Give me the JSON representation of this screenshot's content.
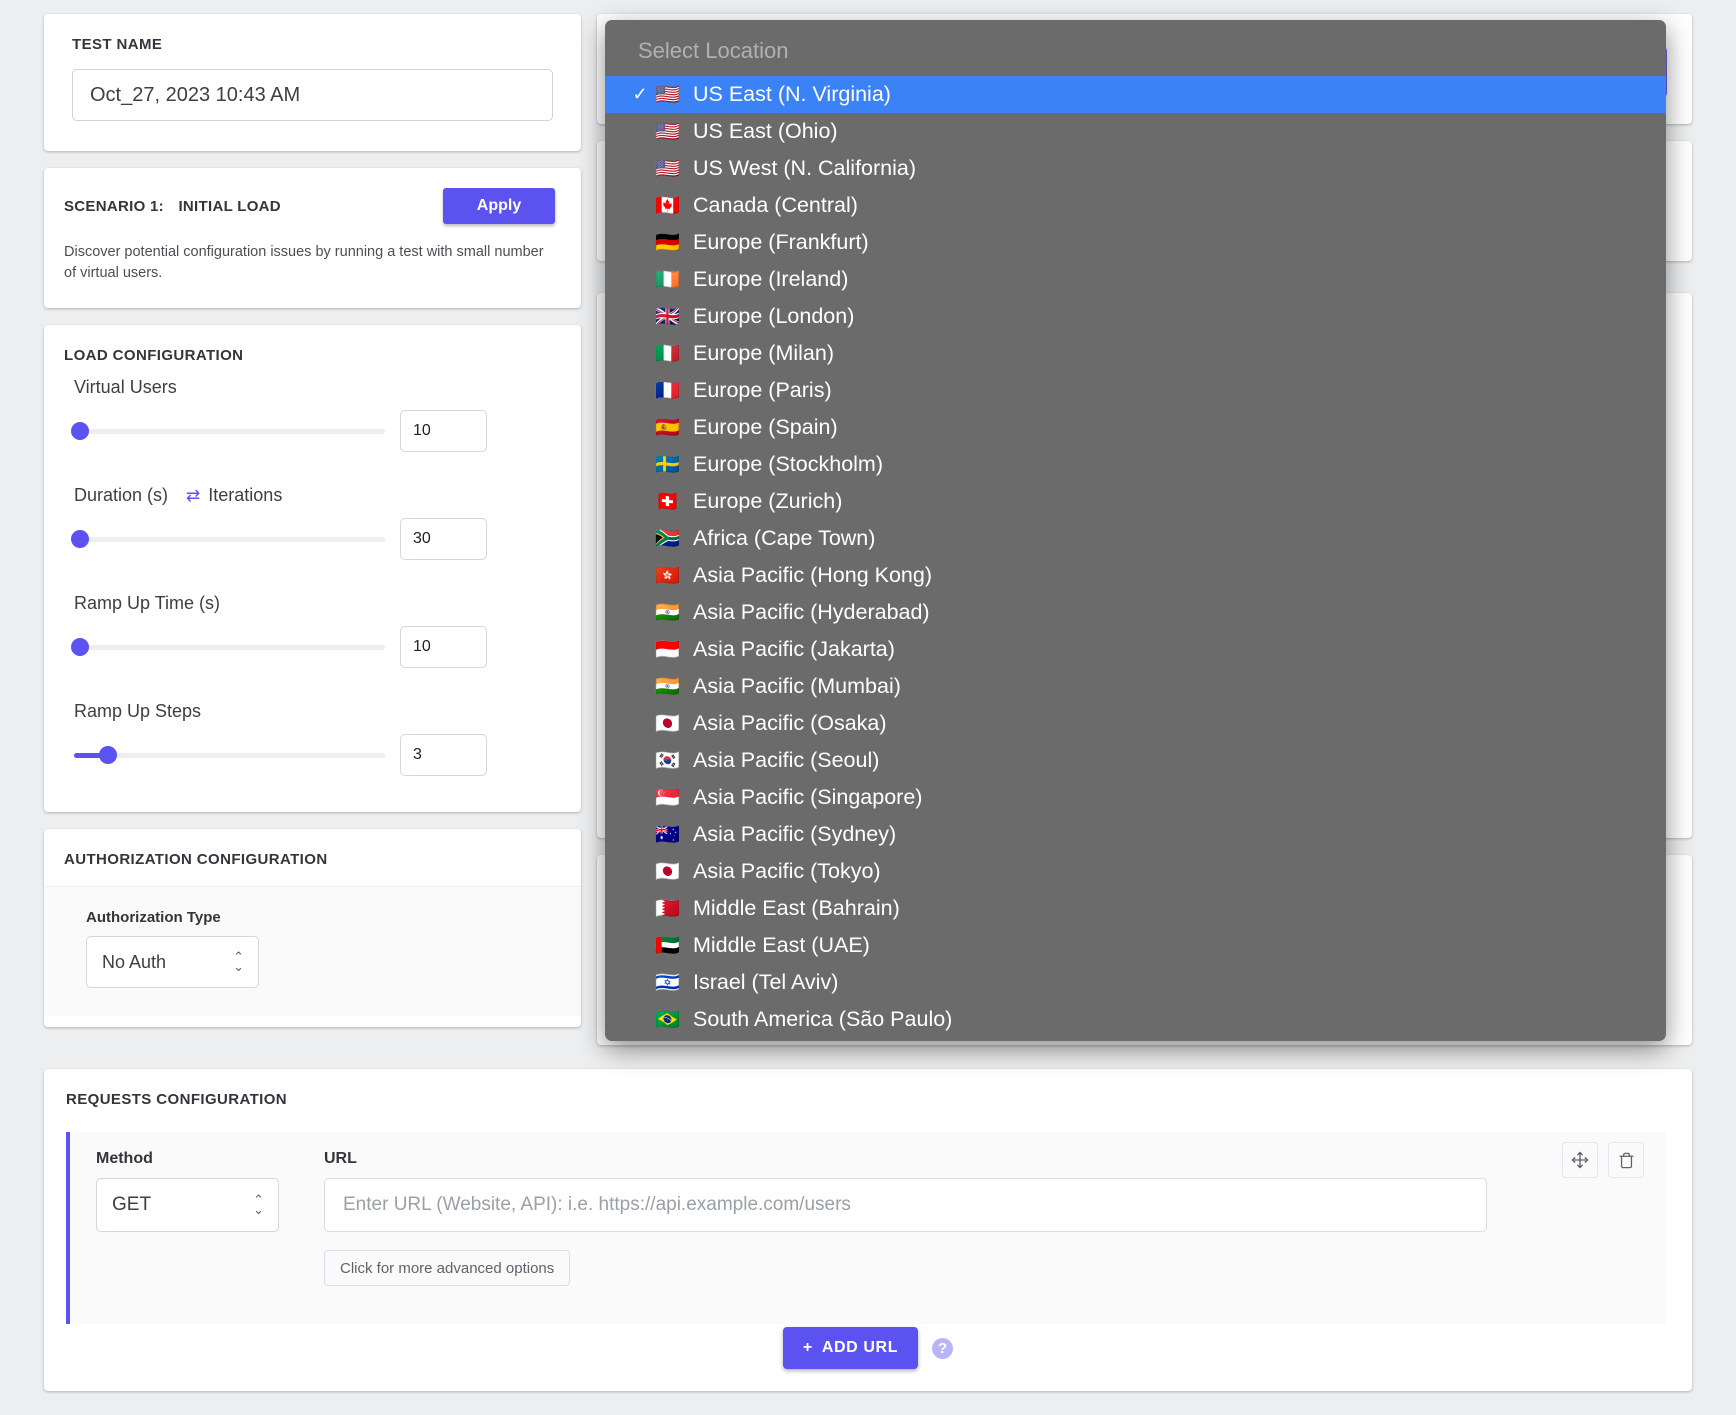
{
  "test_name": {
    "label": "TEST NAME",
    "value": "Oct_27, 2023 10:43 AM"
  },
  "scenario": {
    "prefix": "SCENARIO 1:",
    "name": "INITIAL LOAD",
    "apply_label": "Apply",
    "description": "Discover potential configuration issues by running a test with small number of virtual users."
  },
  "load_configuration": {
    "title": "LOAD CONFIGURATION",
    "fields": [
      {
        "label": "Virtual Users",
        "value": "10",
        "slider_percent": 2
      },
      {
        "label": "Duration (s)",
        "alt_label": "Iterations",
        "swap_icon": "swap-horizontal-icon",
        "value": "30",
        "slider_percent": 2
      },
      {
        "label": "Ramp Up Time (s)",
        "value": "10",
        "slider_percent": 2
      },
      {
        "label": "Ramp Up Steps",
        "value": "3",
        "slider_percent": 11
      }
    ]
  },
  "authorization": {
    "title": "AUTHORIZATION CONFIGURATION",
    "type_label": "Authorization Type",
    "type_value": "No Auth"
  },
  "requests": {
    "title": "REQUESTS CONFIGURATION",
    "method_label": "Method",
    "method_value": "GET",
    "url_label": "URL",
    "url_value": "",
    "url_placeholder": "Enter URL (Website, API): i.e. https://api.example.com/users",
    "advanced_label": "Click for more advanced options",
    "move_icon": "move-icon",
    "delete_icon": "trash-icon",
    "add_url_label": "ADD URL",
    "add_url_plus": "+",
    "help_icon": "help-icon",
    "help_label": "?"
  },
  "location_dropdown": {
    "header": "Select Location",
    "selected_index": 0,
    "check_glyph": "✓",
    "items": [
      {
        "flag": "🇺🇸",
        "label": "US East (N. Virginia)"
      },
      {
        "flag": "🇺🇸",
        "label": "US East (Ohio)"
      },
      {
        "flag": "🇺🇸",
        "label": "US West (N. California)"
      },
      {
        "flag": "🇨🇦",
        "label": "Canada (Central)"
      },
      {
        "flag": "🇩🇪",
        "label": "Europe (Frankfurt)"
      },
      {
        "flag": "🇮🇪",
        "label": "Europe (Ireland)"
      },
      {
        "flag": "🇬🇧",
        "label": "Europe (London)"
      },
      {
        "flag": "🇮🇹",
        "label": "Europe (Milan)"
      },
      {
        "flag": "🇫🇷",
        "label": "Europe (Paris)"
      },
      {
        "flag": "🇪🇸",
        "label": "Europe (Spain)"
      },
      {
        "flag": "🇸🇪",
        "label": "Europe (Stockholm)"
      },
      {
        "flag": "🇨🇭",
        "label": "Europe (Zurich)"
      },
      {
        "flag": "🇿🇦",
        "label": "Africa (Cape Town)"
      },
      {
        "flag": "🇭🇰",
        "label": "Asia Pacific (Hong Kong)"
      },
      {
        "flag": "🇮🇳",
        "label": "Asia Pacific (Hyderabad)"
      },
      {
        "flag": "🇮🇩",
        "label": "Asia Pacific (Jakarta)"
      },
      {
        "flag": "🇮🇳",
        "label": "Asia Pacific (Mumbai)"
      },
      {
        "flag": "🇯🇵",
        "label": "Asia Pacific (Osaka)"
      },
      {
        "flag": "🇰🇷",
        "label": "Asia Pacific (Seoul)"
      },
      {
        "flag": "🇸🇬",
        "label": "Asia Pacific (Singapore)"
      },
      {
        "flag": "🇦🇺",
        "label": "Asia Pacific (Sydney)"
      },
      {
        "flag": "🇯🇵",
        "label": "Asia Pacific (Tokyo)"
      },
      {
        "flag": "🇧🇭",
        "label": "Middle East (Bahrain)"
      },
      {
        "flag": "🇦🇪",
        "label": "Middle East (UAE)"
      },
      {
        "flag": "🇮🇱",
        "label": "Israel (Tel Aviv)"
      },
      {
        "flag": "🇧🇷",
        "label": "South America (São Paulo)"
      }
    ]
  },
  "colors": {
    "accent": "#5b52f0",
    "selected": "#3b82f6",
    "dropdown_bg": "#6b6b6b",
    "page_bg": "#eceef0"
  }
}
